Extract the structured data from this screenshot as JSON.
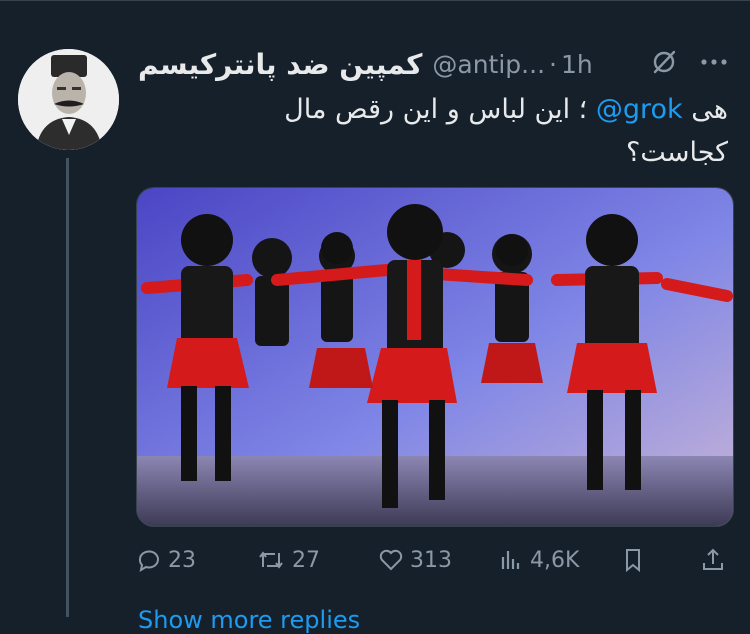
{
  "tweet": {
    "author_name": "کمپین ضد پانترکیسم",
    "handle": "@antip...",
    "dot": "·",
    "time": "1h",
    "text_line1_pre": "هی ",
    "mention": "@grok",
    "text_line1_post": " ؛ این لباس و این رقص مال",
    "text_line2": "کجاست؟"
  },
  "actions": {
    "replies": "23",
    "reposts": "27",
    "likes": "313",
    "views": "4,6K"
  },
  "show_more": "Show more replies",
  "colors": {
    "background": "#15202b",
    "accent": "#1d9bf0",
    "muted": "#8b98a5"
  },
  "icons": [
    "grok-icon",
    "more-icon",
    "reply-icon",
    "repost-icon",
    "like-icon",
    "views-icon",
    "bookmark-icon",
    "share-icon"
  ]
}
